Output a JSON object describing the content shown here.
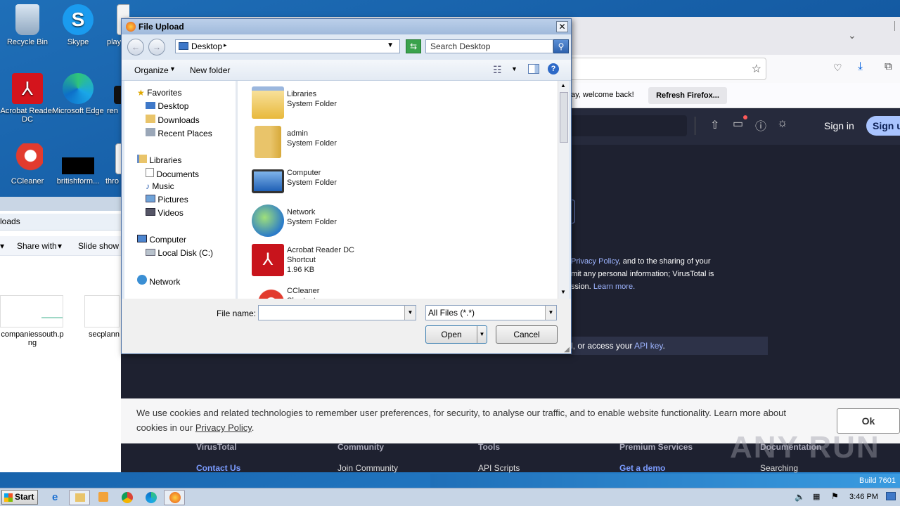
{
  "desktop": {
    "icons": [
      {
        "label": "Recycle Bin"
      },
      {
        "label": "Skype"
      },
      {
        "label": "play"
      },
      {
        "label": "Acrobat Reader DC"
      },
      {
        "label": "Microsoft Edge"
      },
      {
        "label": "ren"
      },
      {
        "label": "CCleaner"
      },
      {
        "label": "britishform..."
      },
      {
        "label": "thro"
      }
    ]
  },
  "explorer": {
    "address_fragment": "loads",
    "toolbar_share": "Share with",
    "toolbar_slideshow": "Slide show",
    "files": [
      {
        "name": "companiessouth.png"
      },
      {
        "name": "secplann"
      }
    ]
  },
  "browser": {
    "notification": "ay, welcome back!",
    "refresh_button": "Refresh Firefox...",
    "signin": "Sign in",
    "signup": "Sign u",
    "terms_line1_link": "Privacy Policy",
    "terms_line1_rest": ", and to the sharing of your",
    "terms_line2": "mit any personal information; VirusTotal is",
    "terms_line3_pre": "ssion.",
    "terms_line3_link": "Learn more.",
    "api_line_pre": "l, or access your",
    "api_link": "API key",
    "api_line_post": ".",
    "cookie_text": "We use cookies and related technologies to remember user preferences, for security, to analyse our traffic, and to enable website functionality. Learn more about cookies in our",
    "cookie_link": "Privacy Policy",
    "cookie_ok": "Ok",
    "footer_cols": [
      "VirusTotal",
      "Community",
      "Tools",
      "Premium Services",
      "Documentation"
    ],
    "footer_links": [
      "Contact Us",
      "Join Community",
      "API Scripts",
      "Get a demo",
      "Searching"
    ]
  },
  "dialog": {
    "title": "File Upload",
    "address": "Desktop",
    "search_placeholder": "Search Desktop",
    "organize": "Organize",
    "new_folder": "New folder",
    "nav": {
      "favorites": "Favorites",
      "desktop": "Desktop",
      "downloads": "Downloads",
      "recent": "Recent Places",
      "libraries": "Libraries",
      "documents": "Documents",
      "music": "Music",
      "pictures": "Pictures",
      "videos": "Videos",
      "computer": "Computer",
      "local_disk": "Local Disk (C:)",
      "network": "Network"
    },
    "items": [
      {
        "name": "Libraries",
        "type": "System Folder",
        "size": ""
      },
      {
        "name": "admin",
        "type": "System Folder",
        "size": ""
      },
      {
        "name": "Computer",
        "type": "System Folder",
        "size": ""
      },
      {
        "name": "Network",
        "type": "System Folder",
        "size": ""
      },
      {
        "name": "Acrobat Reader DC",
        "type": "Shortcut",
        "size": "1.96 KB"
      },
      {
        "name": "CCleaner",
        "type": "Shortcut",
        "size": ""
      }
    ],
    "file_name_label": "File name:",
    "file_name_value": "",
    "file_type": "All Files (*.*)",
    "open": "Open",
    "cancel": "Cancel"
  },
  "taskbar": {
    "start": "Start",
    "time": "3:46 PM",
    "build": "Build 7601"
  },
  "watermark": "ANY RUN"
}
